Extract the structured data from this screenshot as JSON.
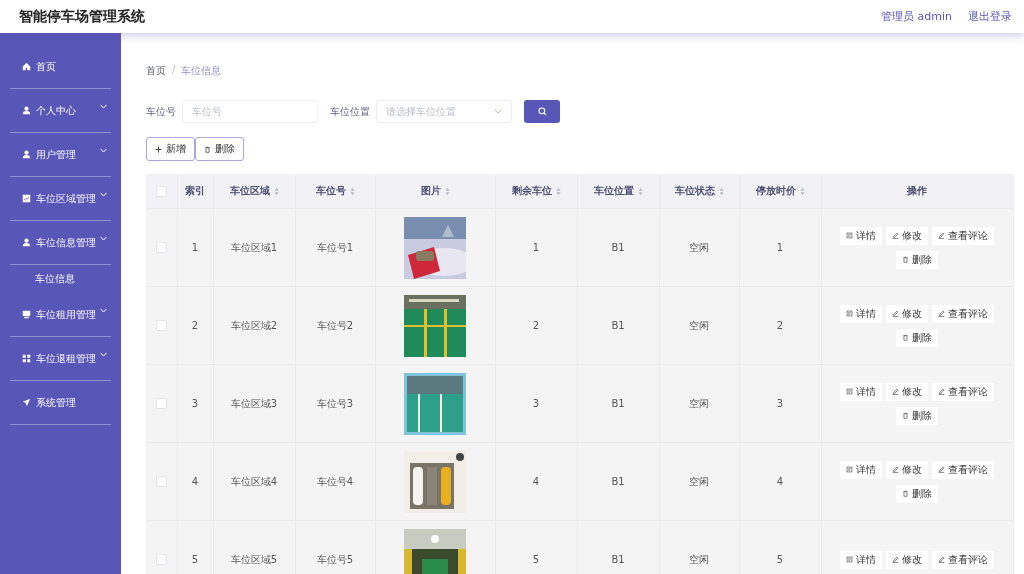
{
  "header": {
    "title": "智能停车场管理系统",
    "user": "管理员 admin",
    "logout": "退出登录"
  },
  "sidebar": {
    "items": [
      {
        "label": "首页",
        "expandable": false
      },
      {
        "label": "个人中心",
        "expandable": true,
        "expanded": false
      },
      {
        "label": "用户管理",
        "expandable": true,
        "expanded": false
      },
      {
        "label": "车位区域管理",
        "expandable": true,
        "expanded": false
      },
      {
        "label": "车位信息管理",
        "expandable": true,
        "expanded": true,
        "children": [
          {
            "label": "车位信息"
          }
        ]
      },
      {
        "label": "车位租用管理",
        "expandable": true,
        "expanded": false
      },
      {
        "label": "车位退租管理",
        "expandable": true,
        "expanded": false
      },
      {
        "label": "系统管理",
        "expandable": false
      }
    ]
  },
  "breadcrumb": {
    "items": [
      "首页",
      "车位信息"
    ],
    "separator": "/"
  },
  "search": {
    "fields": [
      {
        "label": "车位号",
        "placeholder": "车位号",
        "kind": "input"
      },
      {
        "label": "车位位置",
        "placeholder": "请选择车位位置",
        "kind": "select"
      }
    ]
  },
  "actions": [
    "新增",
    "删除"
  ],
  "table": {
    "select_all": {
      "checked": false
    },
    "columns": [
      {
        "label": "索引",
        "sortable": false
      },
      {
        "label": "车位区域",
        "sortable": true
      },
      {
        "label": "车位号",
        "sortable": true
      },
      {
        "label": "图片",
        "sortable": true
      },
      {
        "label": "剩余车位",
        "sortable": true
      },
      {
        "label": "车位位置",
        "sortable": true
      },
      {
        "label": "车位状态",
        "sortable": true
      },
      {
        "label": "停放时价",
        "sortable": true
      },
      {
        "label": "操作",
        "sortable": false
      }
    ],
    "rows": [
      {
        "checked": false,
        "cells": [
          "1",
          "车位区域1",
          "车位号1",
          {
            "kind": "picture"
          },
          "1",
          "B1",
          "空闲",
          "1"
        ],
        "actions": [
          "详情",
          "修改",
          "查看评论",
          "删除"
        ]
      },
      {
        "checked": false,
        "cells": [
          "2",
          "车位区域2",
          "车位号2",
          {
            "kind": "picture"
          },
          "2",
          "B1",
          "空闲",
          "2"
        ],
        "actions": [
          "详情",
          "修改",
          "查看评论",
          "删除"
        ]
      },
      {
        "checked": false,
        "cells": [
          "3",
          "车位区域3",
          "车位号3",
          {
            "kind": "picture"
          },
          "3",
          "B1",
          "空闲",
          "3"
        ],
        "actions": [
          "详情",
          "修改",
          "查看评论",
          "删除"
        ]
      },
      {
        "checked": false,
        "cells": [
          "4",
          "车位区域4",
          "车位号4",
          {
            "kind": "picture"
          },
          "4",
          "B1",
          "空闲",
          "4"
        ],
        "actions": [
          "详情",
          "修改",
          "查看评论",
          "删除"
        ]
      },
      {
        "checked": false,
        "cells": [
          "5",
          "车位区域5",
          "车位号5",
          {
            "kind": "picture"
          },
          "5",
          "B1",
          "空闲",
          "5"
        ],
        "actions": [
          "详情",
          "修改",
          "查看评论"
        ]
      }
    ]
  }
}
